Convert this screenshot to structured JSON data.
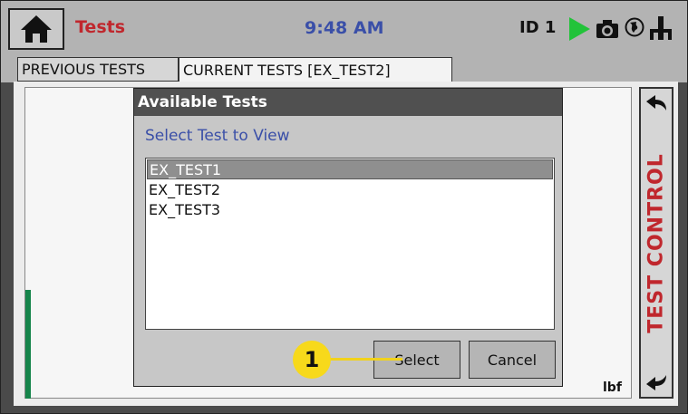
{
  "header": {
    "title": "Tests",
    "time": "9:48 AM",
    "id_label": "ID 1",
    "icons": [
      "home-icon",
      "play-icon",
      "camera-icon",
      "globe-icon",
      "usb-icon"
    ]
  },
  "tabs": [
    {
      "label": "PREVIOUS TESTS"
    },
    {
      "label": "CURRENT TESTS [EX_TEST2]"
    }
  ],
  "dialog": {
    "title": "Available Tests",
    "subtitle": "Select Test to View",
    "items": [
      {
        "label": "EX_TEST1",
        "selected": true
      },
      {
        "label": "EX_TEST2",
        "selected": false
      },
      {
        "label": "EX_TEST3",
        "selected": false
      }
    ],
    "select_label": "Select",
    "cancel_label": "Cancel"
  },
  "test_control": {
    "label": "TEST CONTROL",
    "icons": [
      "arrow-left-icon",
      "arrow-left-icon"
    ]
  },
  "units": "lbf",
  "callout": "1",
  "colors": {
    "accent_red": "#c0272d",
    "accent_blue": "#3a4fa8",
    "play_green": "#22c33a",
    "callout_yellow": "#f7d91b"
  }
}
